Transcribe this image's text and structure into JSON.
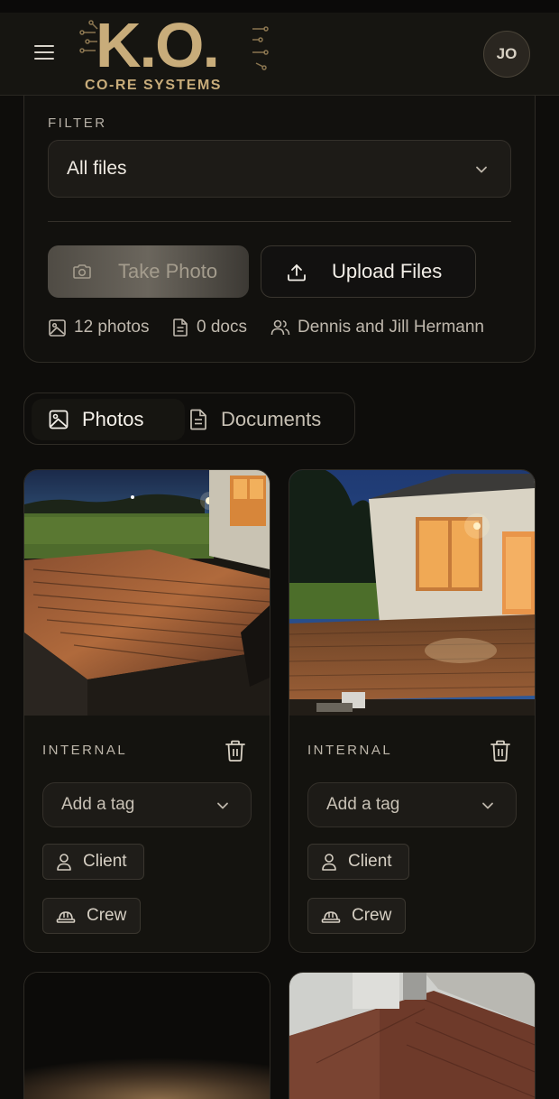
{
  "header": {
    "logo_main": "K.O.",
    "logo_sub": "CO-RE SYSTEMS",
    "avatar_initials": "JO"
  },
  "filter": {
    "label": "FILTER",
    "selected": "All files"
  },
  "actions": {
    "take_photo": "Take Photo",
    "upload_files": "Upload Files"
  },
  "stats": {
    "photos": "12 photos",
    "docs": "0 docs",
    "client": "Dennis and Jill Hermann"
  },
  "tabs": [
    {
      "label": "Photos",
      "active": true
    },
    {
      "label": "Documents",
      "active": false
    }
  ],
  "photos": [
    {
      "visibility": "INTERNAL",
      "tag_placeholder": "Add a tag",
      "chips": [
        "Client",
        "Crew"
      ]
    },
    {
      "visibility": "INTERNAL",
      "tag_placeholder": "Add a tag",
      "chips": [
        "Client",
        "Crew"
      ]
    }
  ],
  "colors": {
    "accent_gold": "#c8ac7a",
    "background": "#0e0d0b",
    "card": "#14130f"
  }
}
